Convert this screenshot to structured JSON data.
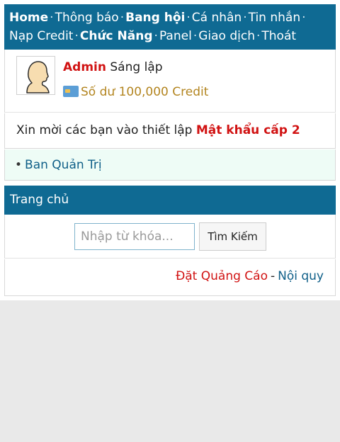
{
  "nav": {
    "items": [
      {
        "label": "Home",
        "bold": true
      },
      {
        "label": "Thông báo",
        "bold": false
      },
      {
        "label": "Bang hội",
        "bold": true
      },
      {
        "label": "Cá nhân",
        "bold": false
      },
      {
        "label": "Tin nhắn",
        "bold": false
      },
      {
        "label": "Nạp Credit",
        "bold": false
      },
      {
        "label": "Chức Năng",
        "bold": true
      },
      {
        "label": "Panel",
        "bold": false
      },
      {
        "label": "Giao dịch",
        "bold": false
      },
      {
        "label": "Thoát",
        "bold": false
      }
    ],
    "separator": "·"
  },
  "user": {
    "name": "Admin",
    "role": "Sáng lập",
    "balance": "Số dư 100,000 Credit",
    "avatar_icon": "user-silhouette-icon",
    "balance_icon": "credit-card-icon"
  },
  "notice": {
    "text": "Xin mời các bạn vào thiết lập ",
    "link": "Mật khẩu cấp 2"
  },
  "admin_link": {
    "bullet": "•",
    "label": "Ban Quản Trị"
  },
  "section": {
    "title": "Trang chủ"
  },
  "search": {
    "placeholder": "Nhập từ khóa...",
    "value": "",
    "button": "Tìm Kiếm"
  },
  "footer": {
    "ads": "Đặt Quảng Cáo",
    "separator": "-",
    "rules": "Nội quy"
  },
  "colors": {
    "header_bg": "#0f6a93",
    "red": "#d11313",
    "link_blue": "#0f5f88",
    "gold": "#b38520",
    "admin_bg": "#eefcf6",
    "page_bg": "#e9e9e9"
  }
}
